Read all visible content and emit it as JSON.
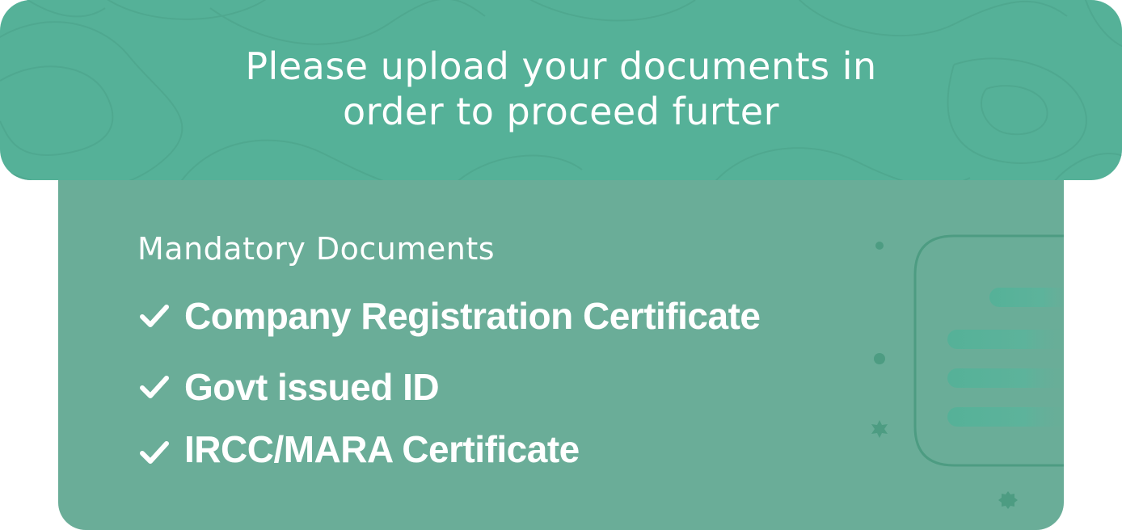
{
  "header": {
    "title_line1": "Please upload your documents in",
    "title_line2": "order to proceed furter"
  },
  "documents": {
    "section_title": "Mandatory Documents",
    "items": [
      {
        "label": "Company Registration Certificate",
        "icon": "check-icon"
      },
      {
        "label": "Govt issued ID",
        "icon": "check-icon"
      },
      {
        "label": "IRCC/MARA Certificate",
        "icon": "check-icon"
      }
    ]
  },
  "colors": {
    "header_bg": "#55b198",
    "panel_bg": "#6aad98",
    "text": "#ffffff",
    "decor": "#4d9c82"
  }
}
